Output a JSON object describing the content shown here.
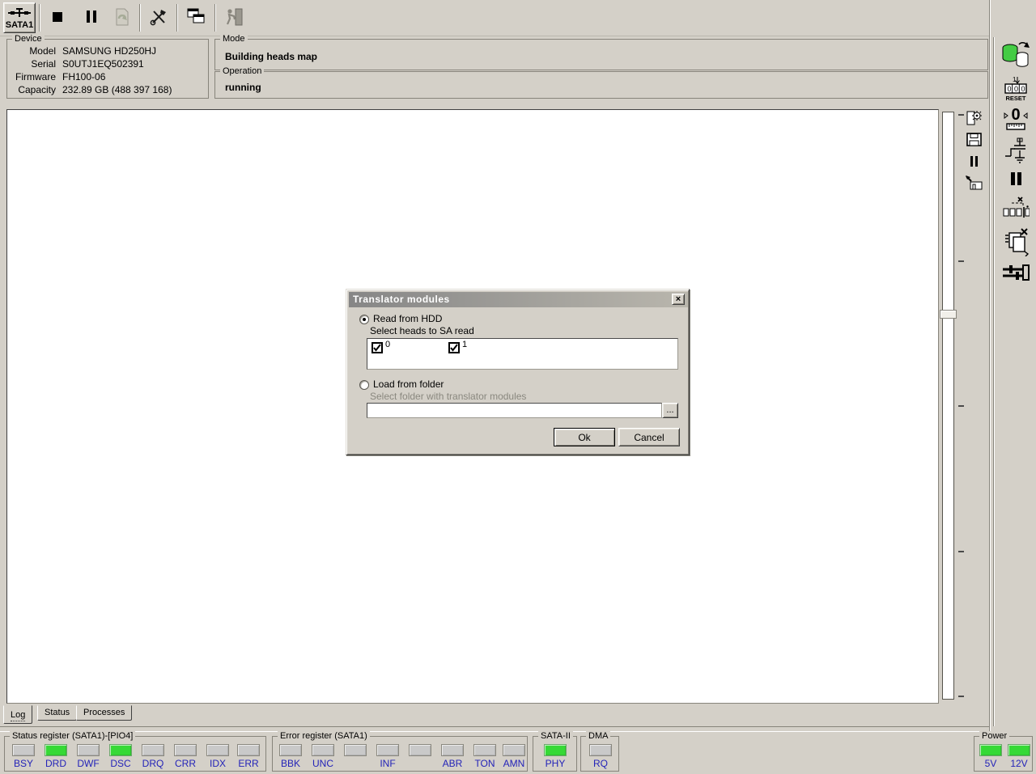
{
  "colors": {
    "bg": "#d4d0c8",
    "led_on": "#36d936",
    "led_off": "#c9c9c9",
    "label_blue": "#2323b8"
  },
  "toolbar": {
    "sata_label": "SATA1"
  },
  "device": {
    "title": "Device",
    "fields": [
      {
        "label": "Model",
        "value": "SAMSUNG HD250HJ"
      },
      {
        "label": "Serial",
        "value": "S0UTJ1EQ502391"
      },
      {
        "label": "Firmware",
        "value": "FH100-06"
      },
      {
        "label": "Capacity",
        "value": "232.89 GB (488 397 168)"
      }
    ]
  },
  "mode": {
    "title": "Mode",
    "value": "Building heads map"
  },
  "operation": {
    "title": "Operation",
    "value": "running"
  },
  "tabs": [
    {
      "label": "Log",
      "active": true
    },
    {
      "label": "Status",
      "active": false
    },
    {
      "label": "Processes",
      "active": false
    }
  ],
  "right_toolbar": {
    "reset_one": "1",
    "zero_digit": "0",
    "reset_label": "RESET"
  },
  "dialog": {
    "title": "Translator modules",
    "close_glyph": "×",
    "read_option": {
      "label": "Read from HDD",
      "selected": true,
      "hint": "Select heads to SA read"
    },
    "heads": [
      {
        "label": "0",
        "checked": true
      },
      {
        "label": "1",
        "checked": true
      }
    ],
    "load_option": {
      "label": "Load from folder",
      "selected": false,
      "hint": "Select folder with translator modules"
    },
    "folder_input": {
      "value": "",
      "placeholder": ""
    },
    "browse_label": "...",
    "ok_label": "Ok",
    "cancel_label": "Cancel"
  },
  "status_bar": {
    "status_register": {
      "title": "Status register (SATA1)-[PIO4]",
      "leds": [
        {
          "label": "BSY",
          "on": false
        },
        {
          "label": "DRD",
          "on": true
        },
        {
          "label": "DWF",
          "on": false
        },
        {
          "label": "DSC",
          "on": true
        },
        {
          "label": "DRQ",
          "on": false
        },
        {
          "label": "CRR",
          "on": false
        },
        {
          "label": "IDX",
          "on": false
        },
        {
          "label": "ERR",
          "on": false
        }
      ]
    },
    "error_register": {
      "title": "Error register (SATA1)",
      "leds": [
        {
          "label": "BBK",
          "on": false
        },
        {
          "label": "UNC",
          "on": false
        },
        {
          "label": "",
          "on": false
        },
        {
          "label": "INF",
          "on": false
        },
        {
          "label": "",
          "on": false
        },
        {
          "label": "ABR",
          "on": false
        },
        {
          "label": "TON",
          "on": false
        },
        {
          "label": "AMN",
          "on": false
        }
      ]
    },
    "sata": {
      "title": "SATA-II",
      "leds": [
        {
          "label": "PHY",
          "on": true
        }
      ]
    },
    "dma": {
      "title": "DMA",
      "leds": [
        {
          "label": "RQ",
          "on": false
        }
      ]
    },
    "power": {
      "title": "Power",
      "leds": [
        {
          "label": "5V",
          "on": true
        },
        {
          "label": "12V",
          "on": true
        }
      ]
    }
  }
}
